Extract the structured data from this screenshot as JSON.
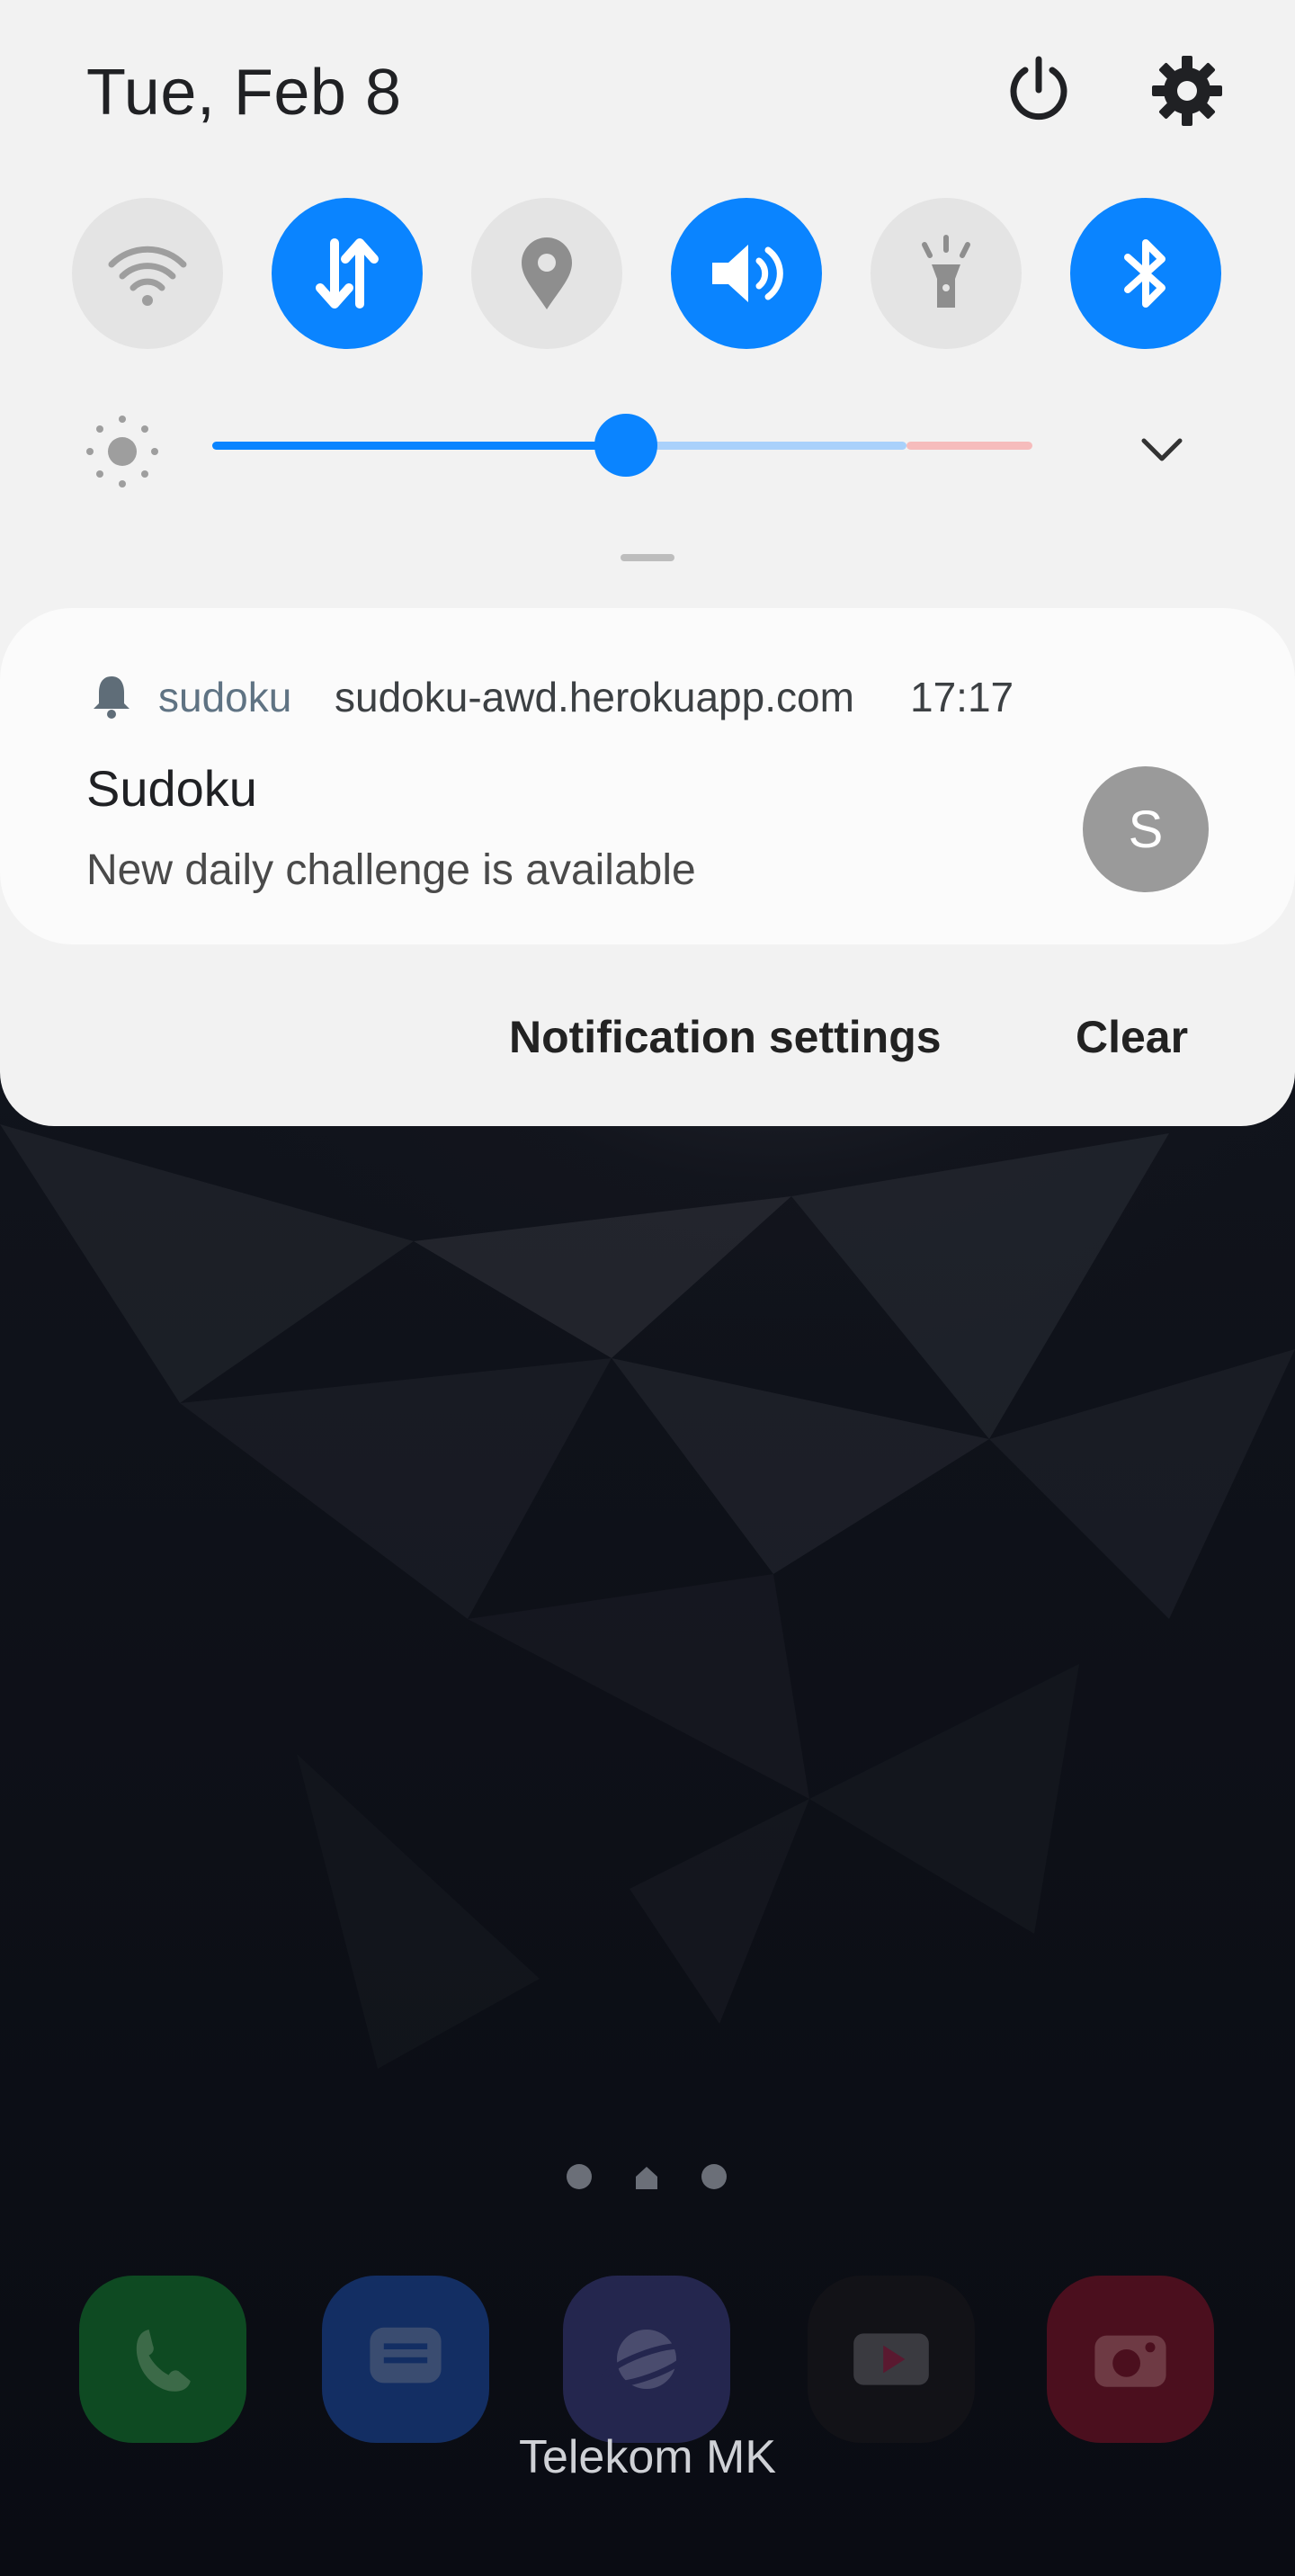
{
  "status": {
    "date": "Tue, Feb 8"
  },
  "quick_settings": {
    "tiles": [
      {
        "icon": "wifi-icon",
        "state": "off"
      },
      {
        "icon": "mobile-data-icon",
        "state": "on"
      },
      {
        "icon": "location-icon",
        "state": "off"
      },
      {
        "icon": "sound-icon",
        "state": "on"
      },
      {
        "icon": "flashlight-icon",
        "state": "off"
      },
      {
        "icon": "bluetooth-icon",
        "state": "on"
      }
    ],
    "brightness_level": 0.5,
    "accent_color": "#0a84ff"
  },
  "notification": {
    "app": "sudoku",
    "source": "sudoku-awd.herokuapp.com",
    "time": "17:17",
    "title": "Sudoku",
    "text": "New daily challenge is available",
    "avatar_letter": "S"
  },
  "actions": {
    "settings_label": "Notification settings",
    "clear_label": "Clear"
  },
  "home": {
    "dock": [
      {
        "icon": "phone-icon",
        "color": "#0e4a22"
      },
      {
        "icon": "messages-icon",
        "color": "#132e63"
      },
      {
        "icon": "internet-icon",
        "color": "#24264e"
      },
      {
        "icon": "youtube-icon",
        "color": "#121217"
      },
      {
        "icon": "camera-icon",
        "color": "#4b0f1e"
      }
    ],
    "carrier": "Telekom MK"
  }
}
